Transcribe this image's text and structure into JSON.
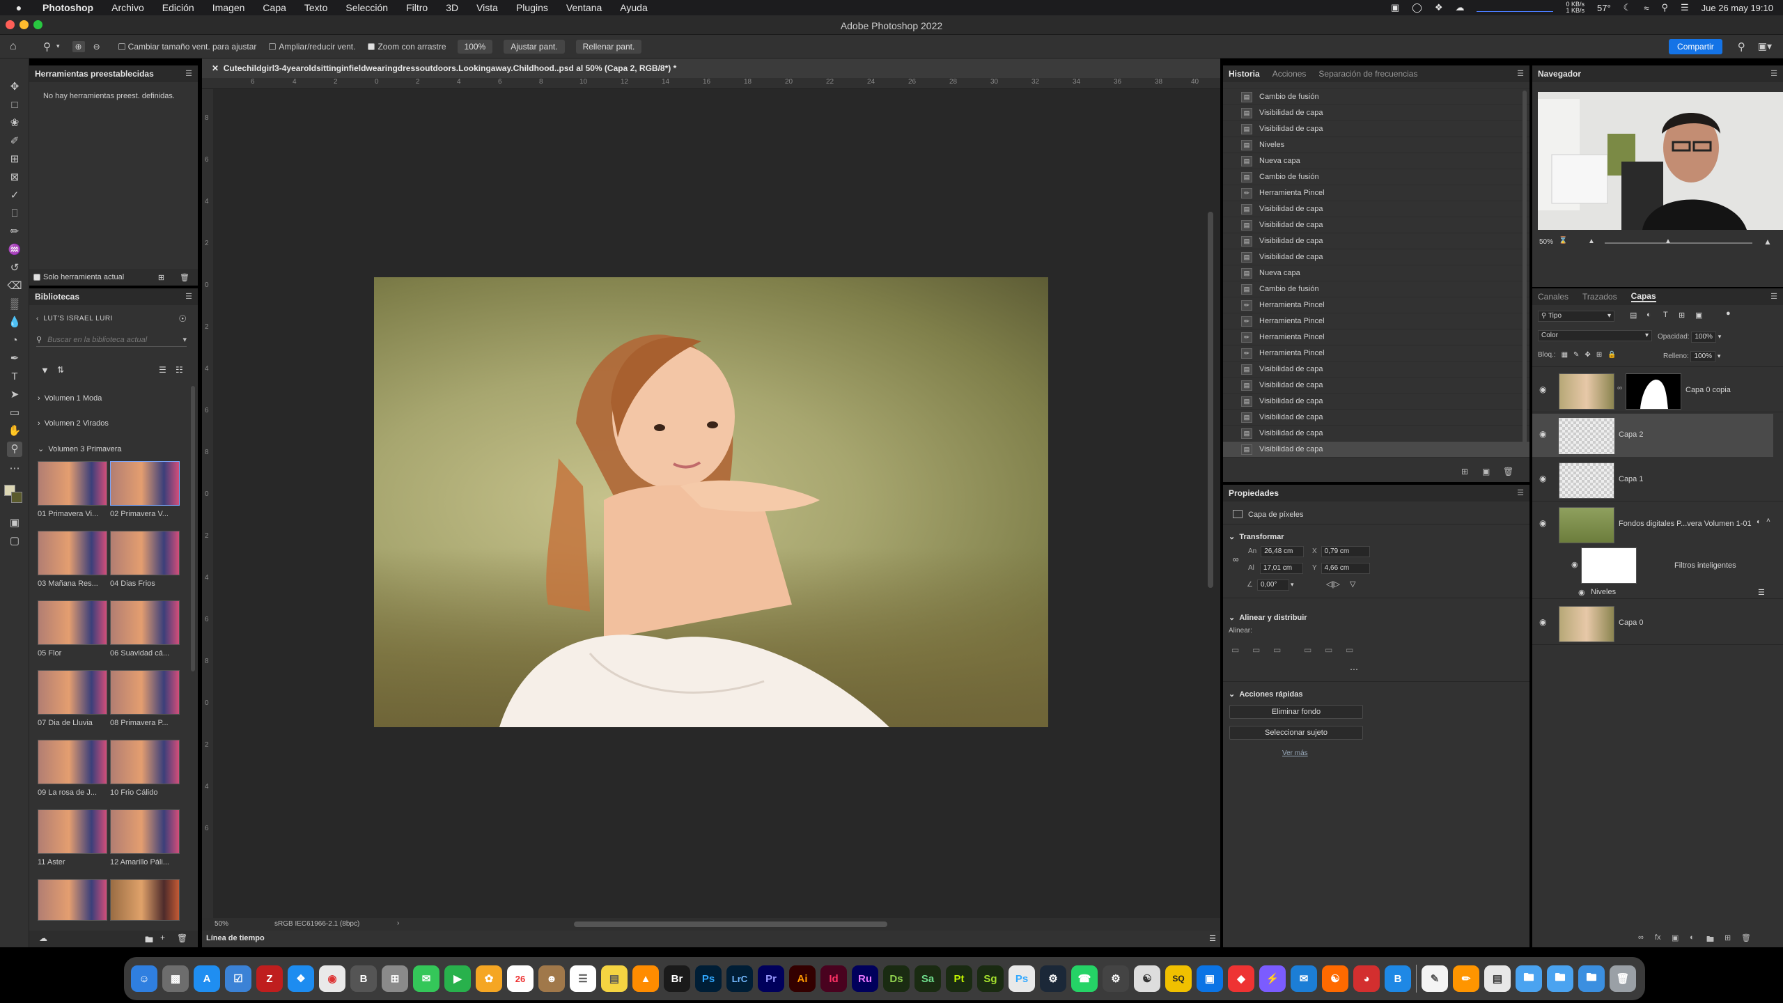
{
  "menubar": {
    "app": "Photoshop",
    "items": [
      "Archivo",
      "Edición",
      "Imagen",
      "Capa",
      "Texto",
      "Selección",
      "Filtro",
      "3D",
      "Vista",
      "Plugins",
      "Ventana",
      "Ayuda"
    ],
    "net_up": "0 KB/s",
    "net_down": "1 KB/s",
    "temp": "57°",
    "datetime": "Jue 26 may  19:10"
  },
  "window": {
    "title": "Adobe Photoshop 2022"
  },
  "options": {
    "cb1": "Cambiar tamaño vent. para ajustar",
    "cb2": "Ampliar/reducir vent.",
    "cb3": "Zoom con arrastre",
    "zoom": "100%",
    "fit": "Ajustar pant.",
    "fill": "Rellenar pant.",
    "share": "Compartir"
  },
  "presets": {
    "title": "Herramientas preestablecidas",
    "empty": "No hay herramientas preest. definidas.",
    "only_current": "Solo herramienta actual"
  },
  "libraries": {
    "title": "Bibliotecas",
    "library": "LUT'S ISRAEL LURI",
    "search_placeholder": "Buscar en la biblioteca actual",
    "groups": [
      "Volumen 1 Moda",
      "Volumen 2 Virados",
      "Volumen 3 Primavera"
    ],
    "tiles": [
      "01 Primavera Vi...",
      "02 Primavera V...",
      "03 Mañana Res...",
      "04 Dias Frios",
      "05 Flor",
      "06 Suavidad cá...",
      "07 Dia de Lluvia",
      "08 Primavera P...",
      "09 La rosa de J...",
      "10 Frio Cálido",
      "11 Aster",
      "12 Amarillo Páli..."
    ]
  },
  "document": {
    "tab": "Cutechildgirl3-4yearoldsittinginfieldwearingdressoutdoors.Lookingaway.Childhood..psd al 50% (Capa 2, RGB/8*) *",
    "zoom": "50%",
    "profile": "sRGB IEC61966-2.1 (8bpc)",
    "ruler_h": [
      "6",
      "4",
      "2",
      "0",
      "2",
      "4",
      "6",
      "8",
      "10",
      "12",
      "14",
      "16",
      "18",
      "20",
      "22",
      "24",
      "26",
      "28",
      "30",
      "32",
      "34",
      "36",
      "38",
      "40"
    ],
    "ruler_v": [
      "8",
      "6",
      "4",
      "2",
      "0",
      "2",
      "4",
      "6",
      "8",
      "0",
      "2",
      "4",
      "6",
      "8",
      "0",
      "2",
      "4",
      "6"
    ]
  },
  "timeline": {
    "title": "Línea de tiempo"
  },
  "history": {
    "tabs": [
      "Historia",
      "Acciones",
      "Separación de frecuencias"
    ],
    "items": [
      "Cambio de fusión",
      "Visibilidad de capa",
      "Visibilidad de capa",
      "Niveles",
      "Nueva capa",
      "Cambio de fusión",
      "Herramienta Pincel",
      "Visibilidad de capa",
      "Visibilidad de capa",
      "Visibilidad de capa",
      "Visibilidad de capa",
      "Nueva capa",
      "Cambio de fusión",
      "Herramienta Pincel",
      "Herramienta Pincel",
      "Herramienta Pincel",
      "Herramienta Pincel",
      "Visibilidad de capa",
      "Visibilidad de capa",
      "Visibilidad de capa",
      "Visibilidad de capa",
      "Visibilidad de capa",
      "Visibilidad de capa"
    ]
  },
  "properties": {
    "title": "Propiedades",
    "type": "Capa de píxeles",
    "transform": "Transformar",
    "w_label": "An",
    "w": "26,48 cm",
    "x_label": "X",
    "x": "0,79 cm",
    "h_label": "Al",
    "h": "17,01 cm",
    "y_label": "Y",
    "y": "4,66 cm",
    "angle": "0,00°",
    "align_section": "Alinear y distribuir",
    "align_label": "Alinear:",
    "quick": "Acciones rápidas",
    "remove_bg": "Eliminar fondo",
    "select_subject": "Seleccionar sujeto",
    "more": "Ver más"
  },
  "navigator": {
    "title": "Navegador",
    "zoom": "50%"
  },
  "layers": {
    "tabs": [
      "Canales",
      "Trazados",
      "Capas"
    ],
    "filter": "Tipo",
    "blend": "Color",
    "opacity_label": "Opacidad:",
    "opacity": "100%",
    "lock_label": "Bloq.:",
    "fill_label": "Relleno:",
    "fill": "100%",
    "items": [
      "Capa 0 copia",
      "Capa 2",
      "Capa 1",
      "Fondos digitales P...vera Volumen 1-01",
      "Filtros inteligentes",
      "Niveles",
      "Capa 0"
    ]
  }
}
